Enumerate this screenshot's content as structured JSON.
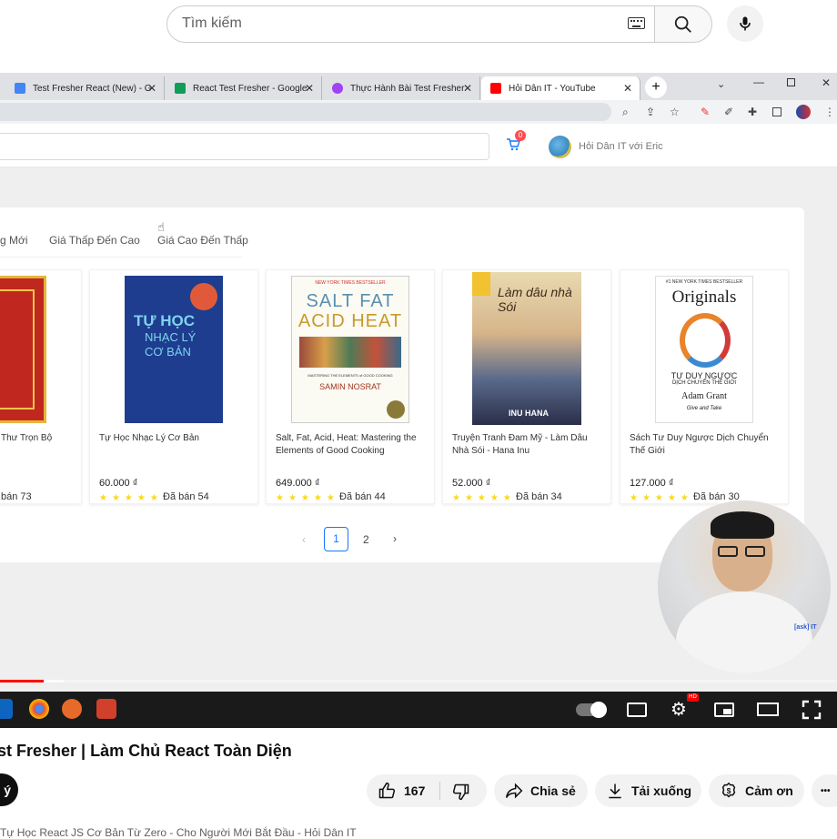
{
  "youtube": {
    "search_placeholder": "Tìm kiếm",
    "video_title": "st Fresher | Làm Chủ React Toàn Diện",
    "subscribe_stub": "ý",
    "like_count": "167",
    "share_label": "Chia sẻ",
    "download_label": "Tải xuống",
    "thanks_label": "Cảm ơn",
    "more_label": "•••",
    "description_peek": "Tự Học React JS Cơ Bản Từ Zero - Cho Người Mới Bắt Đầu - Hỏi Dân IT"
  },
  "browser": {
    "tabs": [
      {
        "title": "Test Fresher React (New) - G",
        "icon_color": "#4285f4"
      },
      {
        "title": "React Test Fresher - Google",
        "icon_color": "#0f9d58"
      },
      {
        "title": "Thực Hành Bài Test Fresher",
        "icon_color": "#a142f4"
      },
      {
        "title": "Hỏi Dân IT - YouTube",
        "icon_color": "#ff0000"
      }
    ],
    "new_tab": "+"
  },
  "site": {
    "cart_count": "0",
    "user_name": "Hỏi Dân IT với Eric",
    "sort_options": [
      "g Mới",
      "Giá Thấp Đến Cao",
      "Giá Cao Đến Thấp"
    ],
    "products": [
      {
        "title": "Thư Trọn Bộ",
        "price": "",
        "sold": "bán 73"
      },
      {
        "title": "Tự Học Nhạc Lý Cơ Bản",
        "price": "60.000 ₫",
        "sold": "Đã bán 54"
      },
      {
        "title": "Salt, Fat, Acid, Heat: Mastering the Elements of Good Cooking",
        "price": "649.000 ₫",
        "sold": "Đã bán 44"
      },
      {
        "title": "Truyện Tranh Đam Mỹ - Làm Dâu Nhà Sói - Hana Inu",
        "price": "52.000 ₫",
        "sold": "Đã bán 34"
      },
      {
        "title": "Sách Tư Duy Ngược Dịch Chuyển Thế Giới",
        "price": "127.000 ₫",
        "sold": "Đã bán 30"
      }
    ],
    "stars": "★★★★★",
    "pagination": {
      "prev": "‹",
      "pages": [
        "1",
        "2"
      ],
      "next": "›"
    }
  },
  "book_covers": {
    "salt_top": "NEW YORK TIMES BESTSELLER",
    "salt_line1": "SALT FAT",
    "salt_line2": "ACID HEAT",
    "salt_sub": "MASTERING THE ELEMENTS of GOOD COOKING",
    "salt_author": "SAMIN NOSRAT",
    "music_title1": "TỰ HỌC",
    "music_title2": "NHẠC LÝ",
    "music_title3": "CƠ BẢN",
    "orig_top": "#1 NEW YORK TIMES BESTSELLER",
    "orig_title": "Originals",
    "orig_vn1": "TƯ DUY NGƯỢC",
    "orig_vn2": "DỊCH CHUYỂN THẾ GIỚI",
    "orig_author": "Adam Grant",
    "orig_tag": "Give and Take",
    "manga_author": "INU HANA",
    "manga_title": "Làm dâu nhà Sói"
  },
  "webcam": {
    "watermark": "[ask] IT"
  }
}
